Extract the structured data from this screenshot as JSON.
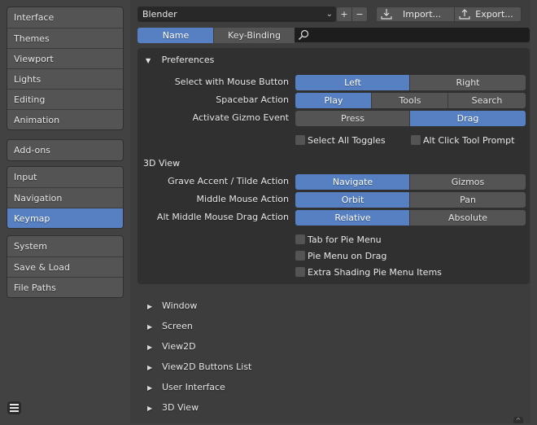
{
  "sidebar": {
    "groups": [
      [
        "Interface",
        "Themes",
        "Viewport",
        "Lights",
        "Editing",
        "Animation"
      ],
      [
        "Add-ons"
      ],
      [
        "Input",
        "Navigation",
        "Keymap"
      ],
      [
        "System",
        "Save & Load",
        "File Paths"
      ]
    ],
    "active": "Keymap",
    "menu_icon": "hamburger-menu-icon"
  },
  "toolbar": {
    "preset_value": "Blender",
    "add_label": "+",
    "remove_label": "−",
    "import_label": "Import...",
    "export_label": "Export..."
  },
  "filter": {
    "tabs": [
      "Name",
      "Key-Binding"
    ],
    "active_tab": "Name",
    "search_value": ""
  },
  "preferences": {
    "title": "Preferences",
    "rows": [
      {
        "label": "Select with Mouse Button",
        "options": [
          "Left",
          "Right"
        ],
        "selected": "Left"
      },
      {
        "label": "Spacebar Action",
        "options": [
          "Play",
          "Tools",
          "Search"
        ],
        "selected": "Play"
      },
      {
        "label": "Activate Gizmo Event",
        "options": [
          "Press",
          "Drag"
        ],
        "selected": "Drag"
      }
    ],
    "checkboxes": [
      {
        "label": "Select All Toggles",
        "checked": false
      },
      {
        "label": "Alt Click Tool Prompt",
        "checked": false
      }
    ],
    "view3d": {
      "title": "3D View",
      "rows": [
        {
          "label": "Grave Accent / Tilde Action",
          "options": [
            "Navigate",
            "Gizmos"
          ],
          "selected": "Navigate"
        },
        {
          "label": "Middle Mouse Action",
          "options": [
            "Orbit",
            "Pan"
          ],
          "selected": "Orbit"
        },
        {
          "label": "Alt Middle Mouse Drag Action",
          "options": [
            "Relative",
            "Absolute"
          ],
          "selected": "Relative"
        }
      ],
      "checkboxes": [
        {
          "label": "Tab for Pie Menu",
          "checked": false
        },
        {
          "label": "Pie Menu on Drag",
          "checked": false
        },
        {
          "label": "Extra Shading Pie Menu Items",
          "checked": false
        }
      ]
    }
  },
  "keymap_sections": [
    "Window",
    "Screen",
    "View2D",
    "View2D Buttons List",
    "User Interface",
    "3D View"
  ]
}
